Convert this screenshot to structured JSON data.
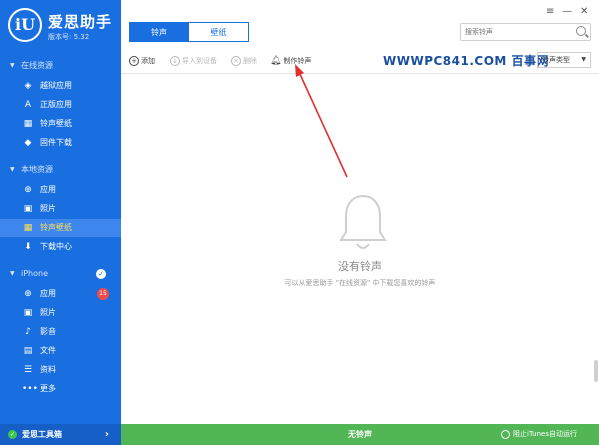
{
  "app": {
    "name": "爱思助手",
    "logo_text": "iU",
    "version": "版本号: 5.32"
  },
  "sidebar": {
    "online": {
      "header": "在线资源",
      "items": [
        {
          "label": "越狱应用",
          "icon": "layers-icon"
        },
        {
          "label": "正版应用",
          "icon": "app-store-icon"
        },
        {
          "label": "铃声壁纸",
          "icon": "ringtone-wallpaper-icon"
        },
        {
          "label": "固件下载",
          "icon": "firmware-icon"
        }
      ]
    },
    "local": {
      "header": "本地资源",
      "items": [
        {
          "label": "应用",
          "icon": "apps-icon"
        },
        {
          "label": "照片",
          "icon": "photo-icon"
        },
        {
          "label": "铃声壁纸",
          "icon": "ringtone-wallpaper-icon",
          "active": true
        },
        {
          "label": "下载中心",
          "icon": "download-icon"
        }
      ]
    },
    "device": {
      "header": "iPhone",
      "items": [
        {
          "label": "应用",
          "icon": "apps-icon",
          "badge": "15"
        },
        {
          "label": "照片",
          "icon": "photo-icon"
        },
        {
          "label": "影音",
          "icon": "music-icon"
        },
        {
          "label": "文件",
          "icon": "file-icon"
        },
        {
          "label": "资料",
          "icon": "contacts-icon"
        },
        {
          "label": "更多",
          "icon": "more-icon"
        }
      ]
    },
    "toolbox": "爱思工具箱"
  },
  "tabs": [
    {
      "label": "铃声",
      "active": true
    },
    {
      "label": "壁纸",
      "active": false
    }
  ],
  "search": {
    "placeholder": "搜索铃声"
  },
  "actions": [
    {
      "label": "添加",
      "enabled": true
    },
    {
      "label": "导入到设备",
      "enabled": false
    },
    {
      "label": "删除",
      "enabled": false
    },
    {
      "label": "制作铃声",
      "enabled": true
    }
  ],
  "watermark": "WWWPC841.COM 百事网",
  "type_select": {
    "value": "铃声类型"
  },
  "empty": {
    "title": "没有铃声",
    "subtitle": "可以从爱思助手 \"在线资源\" 中下载您喜欢的铃声"
  },
  "statusbar": {
    "center": "无铃声",
    "itunes": "阻止iTunes自动运行"
  },
  "window_controls": {
    "menu": "≡",
    "minimize": "—",
    "close": "✕"
  },
  "colors": {
    "sidebar": "#1a6fe0",
    "active_item": "#3d87ee",
    "active_text": "#ffe055",
    "statusbar": "#52b657",
    "arrow": "#e03030"
  }
}
